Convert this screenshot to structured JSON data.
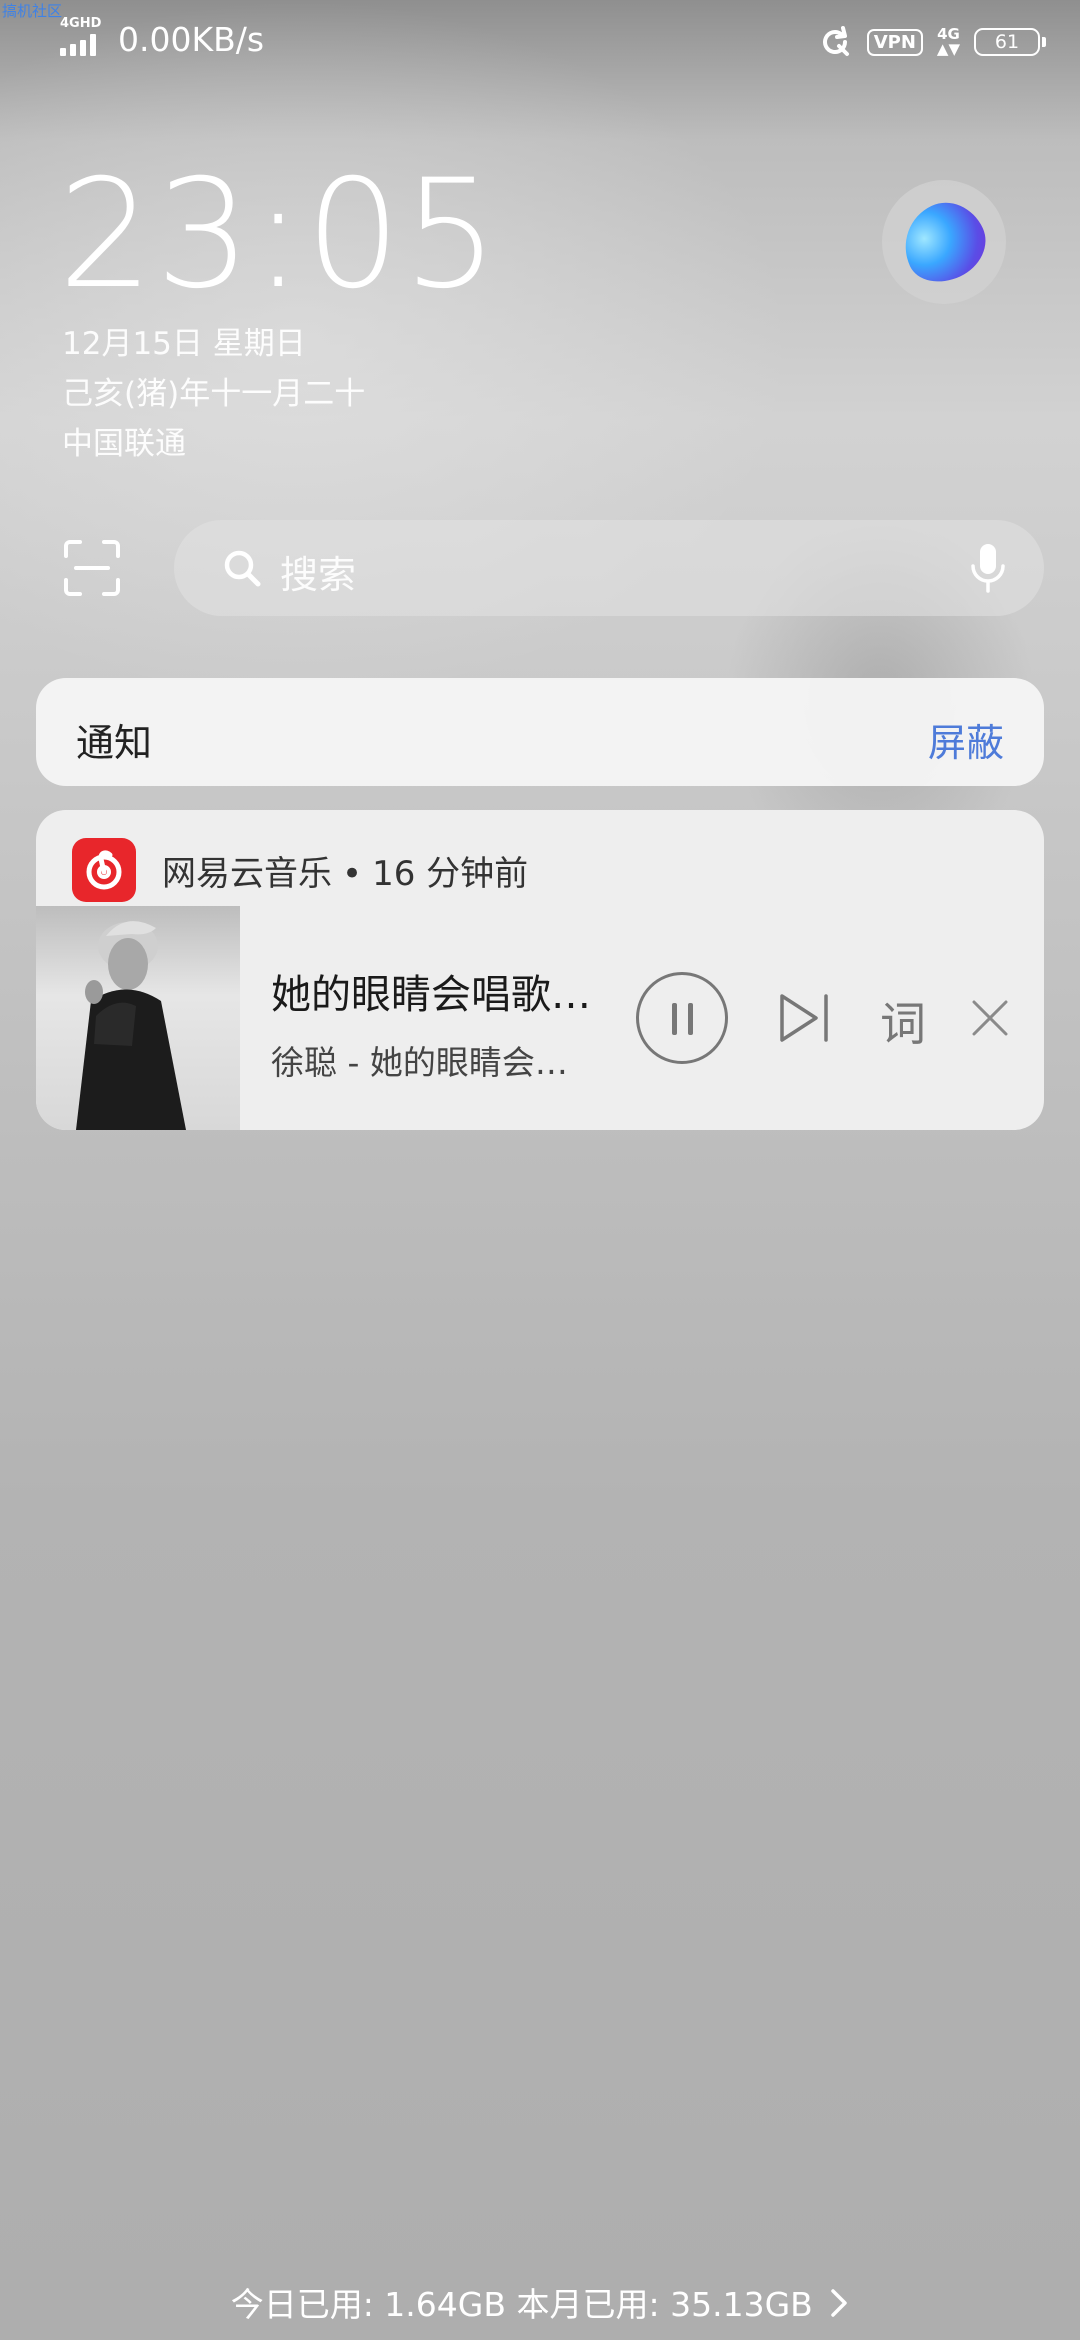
{
  "watermark": "搞机社区",
  "status_bar": {
    "network_tag": "4GHD",
    "speed": "0.00KB/s",
    "vpn": "VPN",
    "lte_top": "4G",
    "battery": "61"
  },
  "lockscreen": {
    "time": "23:05",
    "date": "12月15日 星期日",
    "lunar": "己亥(猪)年十一月二十",
    "carrier": "中国联通"
  },
  "search": {
    "placeholder": "搜索"
  },
  "notification_header": {
    "title": "通知",
    "block_label": "屏蔽"
  },
  "music_notification": {
    "app_name": "网易云音乐",
    "separator": "•",
    "time_ago": "16 分钟前",
    "song_title": "她的眼睛会唱歌…",
    "song_subtitle": "徐聪 - 她的眼睛会…",
    "lyrics_label": "词"
  },
  "footer": {
    "usage": "今日已用: 1.64GB 本月已用: 35.13GB"
  },
  "colors": {
    "accent_blue": "#4e7bd9",
    "netease_red": "#e8262b"
  },
  "icons": [
    "signal-icon",
    "rotation-lock-icon",
    "battery-icon",
    "assistant-orb-icon",
    "scan-icon",
    "search-icon",
    "mic-icon",
    "netease-music-icon",
    "pause-icon",
    "next-track-icon",
    "close-icon",
    "chevron-right-icon"
  ]
}
